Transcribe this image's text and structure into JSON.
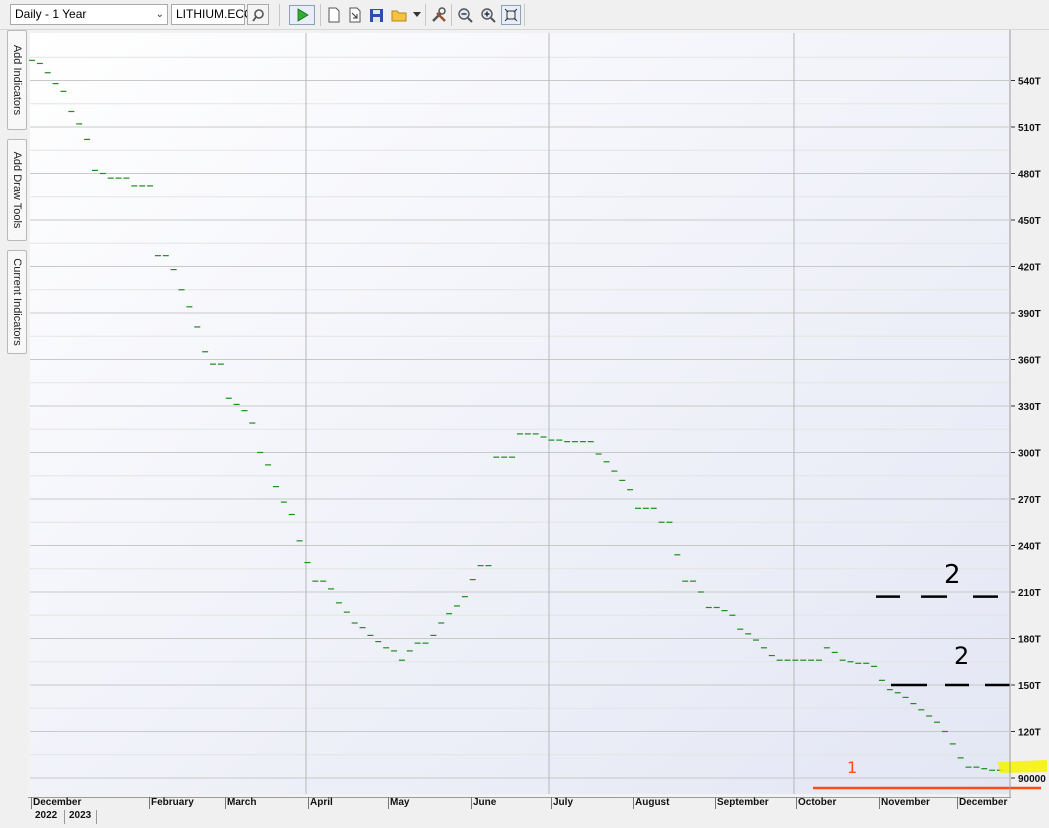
{
  "toolbar": {
    "period_select": "Daily - 1 Year",
    "symbol_input": "LITHIUM.ECO",
    "icons": [
      "search-icon",
      "play-icon",
      "new-page-icon",
      "export-icon",
      "save-icon",
      "open-folder-icon",
      "dropdown-arrow-icon",
      "tools-icon",
      "zoom-out-icon",
      "zoom-in-icon",
      "fit-icon"
    ]
  },
  "side_tabs": {
    "add_indicators": "Add Indicators",
    "add_draw_tools": "Add Draw Tools",
    "current_indicators": "Current Indicators"
  },
  "chart_data": {
    "type": "line",
    "series": [
      {
        "values": [
          553000,
          551000,
          545000,
          538000,
          533000,
          520000,
          512000,
          502000,
          482000,
          480000,
          477000,
          477000,
          477000,
          472000,
          472000,
          472000,
          427000,
          427000,
          418000,
          405000,
          394000,
          381000,
          365000,
          357000,
          357000,
          335000,
          331000,
          327000,
          319000,
          300000,
          292000,
          278000,
          268000,
          260000,
          243000,
          229000,
          217000,
          217000,
          212000,
          203000,
          197000,
          190000,
          187000,
          182000,
          178000,
          174000,
          172000,
          166000,
          172000,
          177000,
          177000,
          182000,
          190000,
          196000,
          201000,
          207000,
          218000,
          227000,
          227000,
          297000,
          297000,
          297000,
          312000,
          312000,
          312000,
          310000,
          308000,
          308000,
          307000,
          307000,
          307000,
          307000,
          299000,
          294000,
          288000,
          282000,
          276000,
          264000,
          264000,
          264000,
          255000,
          255000,
          234000,
          217000,
          217000,
          210000,
          200000,
          200000,
          198000,
          195000,
          186000,
          183000,
          179000,
          174000,
          169000,
          166000,
          166000,
          166000,
          166000,
          166000,
          166000,
          174000,
          171000,
          166000,
          165000,
          164000,
          164000,
          162000,
          153000,
          147000,
          145000,
          142000,
          138000,
          134000,
          130000,
          126000,
          120000,
          112000,
          103000,
          97000,
          97000,
          96000,
          95000,
          95000
        ]
      }
    ],
    "x_labels_months": [
      "December",
      "February",
      "March",
      "April",
      "May",
      "June",
      "July",
      "August",
      "September",
      "October",
      "November",
      "December"
    ],
    "x_labels_years": [
      "2022",
      "2023"
    ],
    "y_ticks": [
      "540T",
      "510T",
      "480T",
      "450T",
      "420T",
      "390T",
      "360T",
      "330T",
      "300T",
      "270T",
      "240T",
      "210T",
      "180T",
      "150T",
      "120T",
      "90000"
    ],
    "ylim": [
      85000,
      572000
    ],
    "grid": true,
    "series_color": "#1e8c1e",
    "annotations": {
      "upper_mark": "2",
      "lower_mark": "2",
      "bottom_mark": "1",
      "dash_color": "#000000",
      "underline_color": "#ff4b14",
      "highlight_color": "#f7f200"
    }
  }
}
